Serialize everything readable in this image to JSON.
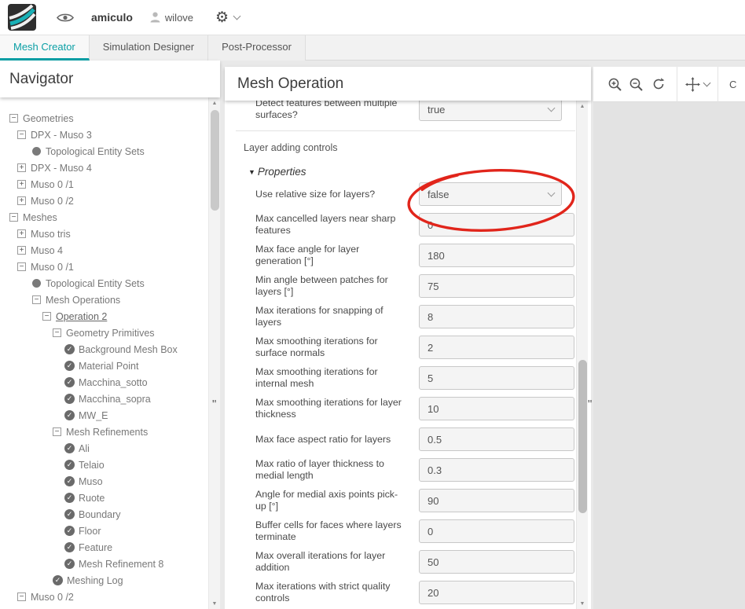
{
  "colors": {
    "accent": "#0b9fa5",
    "annotation": "#e1251b"
  },
  "icons": {
    "gear": "⚙",
    "check": "✓",
    "collapse": "−",
    "expand": "+",
    "triangle_down": "▼",
    "scroll_up": "▲",
    "scroll_down": "▼",
    "handle": "\""
  },
  "topbar": {
    "workspace": "amiculo",
    "username": "wilove"
  },
  "tabs": [
    {
      "label": "Mesh Creator",
      "active": true
    },
    {
      "label": "Simulation Designer",
      "active": false
    },
    {
      "label": "Post-Processor",
      "active": false
    }
  ],
  "navigator": {
    "title": "Navigator",
    "items": [
      {
        "label": "Geometries",
        "level": 0,
        "icon": "collapse"
      },
      {
        "label": "DPX - Muso 3",
        "level": 1,
        "icon": "collapse"
      },
      {
        "label": "Topological Entity Sets",
        "level": 2,
        "icon": "dot"
      },
      {
        "label": "DPX - Muso 4",
        "level": 1,
        "icon": "expand"
      },
      {
        "label": "Muso 0 /1",
        "level": 1,
        "icon": "expand"
      },
      {
        "label": "Muso 0 /2",
        "level": 1,
        "icon": "expand"
      },
      {
        "label": "Meshes",
        "level": 0,
        "icon": "collapse"
      },
      {
        "label": "Muso tris",
        "level": 1,
        "icon": "expand"
      },
      {
        "label": "Muso 4",
        "level": 1,
        "icon": "expand"
      },
      {
        "label": "Muso 0 /1",
        "level": 1,
        "icon": "collapse"
      },
      {
        "label": "Topological Entity Sets",
        "level": 2,
        "icon": "dot"
      },
      {
        "label": "Mesh Operations",
        "level": 2,
        "icon": "collapse"
      },
      {
        "label": "Operation 2",
        "level": 3,
        "icon": "collapse",
        "selected": true
      },
      {
        "label": "Geometry Primitives",
        "level": 4,
        "icon": "collapse"
      },
      {
        "label": "Background Mesh Box",
        "level": 5,
        "icon": "check"
      },
      {
        "label": "Material Point",
        "level": 5,
        "icon": "check"
      },
      {
        "label": "Macchina_sotto",
        "level": 5,
        "icon": "check"
      },
      {
        "label": "Macchina_sopra",
        "level": 5,
        "icon": "check"
      },
      {
        "label": "MW_E",
        "level": 5,
        "icon": "check"
      },
      {
        "label": "Mesh Refinements",
        "level": 4,
        "icon": "collapse"
      },
      {
        "label": "Ali",
        "level": 5,
        "icon": "check"
      },
      {
        "label": "Telaio",
        "level": 5,
        "icon": "check"
      },
      {
        "label": "Muso",
        "level": 5,
        "icon": "check"
      },
      {
        "label": "Ruote",
        "level": 5,
        "icon": "check"
      },
      {
        "label": "Boundary",
        "level": 5,
        "icon": "check"
      },
      {
        "label": "Floor",
        "level": 5,
        "icon": "check"
      },
      {
        "label": "Feature",
        "level": 5,
        "icon": "check"
      },
      {
        "label": "Mesh Refinement 8",
        "level": 5,
        "icon": "check"
      },
      {
        "label": "Meshing Log",
        "level": 4,
        "icon": "check"
      },
      {
        "label": "Muso 0 /2",
        "level": 1,
        "icon": "collapse"
      }
    ]
  },
  "mesh_panel": {
    "title": "Mesh Operation",
    "clipped_field": {
      "label": "Detect features between multiple surfaces?",
      "value": "true"
    },
    "section_label": "Layer adding controls",
    "properties_label": "Properties",
    "fields": [
      {
        "label": "Use relative size for layers?",
        "value": "false",
        "type": "select"
      },
      {
        "label": "Max cancelled layers near sharp features",
        "value": "0",
        "type": "input"
      },
      {
        "label": "Max face angle for layer generation [°]",
        "value": "180",
        "type": "input"
      },
      {
        "label": "Min angle between patches for layers [°]",
        "value": "75",
        "type": "input"
      },
      {
        "label": "Max iterations for snapping of layers",
        "value": "8",
        "type": "input"
      },
      {
        "label": "Max smoothing iterations for surface normals",
        "value": "2",
        "type": "input"
      },
      {
        "label": "Max smoothing iterations for internal mesh",
        "value": "5",
        "type": "input"
      },
      {
        "label": "Max smoothing iterations for layer thickness",
        "value": "10",
        "type": "input"
      },
      {
        "label": "Max face aspect ratio for layers",
        "value": "0.5",
        "type": "input"
      },
      {
        "label": "Max ratio of layer thickness to medial length",
        "value": "0.3",
        "type": "input"
      },
      {
        "label": "Angle for medial axis points pick-up [°]",
        "value": "90",
        "type": "input"
      },
      {
        "label": "Buffer cells for faces where layers terminate",
        "value": "0",
        "type": "input"
      },
      {
        "label": "Max overall iterations for layer addition",
        "value": "50",
        "type": "input"
      },
      {
        "label": "Max iterations with strict quality controls",
        "value": "20",
        "type": "input"
      }
    ]
  },
  "viewport": {
    "partial_label": "C"
  }
}
